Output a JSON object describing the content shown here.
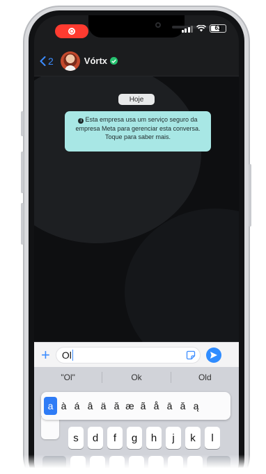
{
  "status_bar": {
    "battery_level": "63",
    "icons": [
      "screen-recording-icon",
      "signal-icon",
      "wifi-icon",
      "battery-icon"
    ]
  },
  "chat_header": {
    "back_count": "2",
    "contact_name": "Vórtx",
    "verified": true,
    "icons": [
      "chevron-left-icon",
      "avatar",
      "verified-badge-icon"
    ]
  },
  "chat": {
    "date_label": "Hoje",
    "notice_text": "Esta empresa usa um serviço seguro da empresa Meta para gerenciar esta conversa. Toque para saber mais.",
    "notice_color": "#a8e7e5"
  },
  "composer": {
    "plus_label": "+",
    "input_value": "Ol",
    "icons": [
      "plus-icon",
      "sticker-icon",
      "send-icon"
    ],
    "send_color": "#2f8cff"
  },
  "keyboard": {
    "predictions": [
      "\"Ol\"",
      "Ok",
      "Old"
    ],
    "accent_options": [
      "a",
      "à",
      "á",
      "â",
      "ä",
      "ă",
      "æ",
      "ã",
      "å",
      "ā",
      "ă",
      "ą"
    ],
    "accent_selected": "a",
    "row_keys": [
      "s",
      "d",
      "f",
      "g",
      "h",
      "j",
      "k",
      "l"
    ]
  }
}
